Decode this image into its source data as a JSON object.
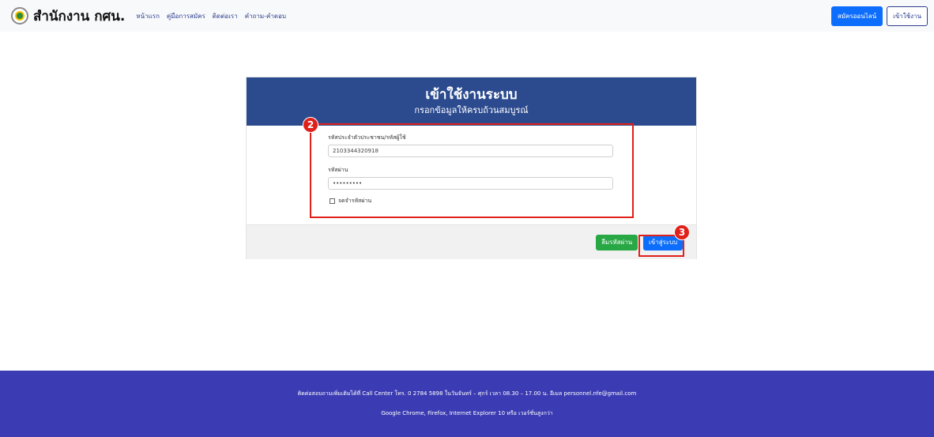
{
  "navbar": {
    "brand": "สำนักงาน กศน.",
    "links": [
      "หน้าแรก",
      "คู่มือการสมัคร",
      "ติดต่อเรา",
      "คำถาม-คำตอบ"
    ],
    "register_label": "สมัครออนไลน์",
    "login_label": "เข้าใช้งาน"
  },
  "login": {
    "title": "เข้าใช้งานระบบ",
    "subtitle": "กรอกข้อมูลให้ครบถ้วนสมบูรณ์",
    "id_label": "รหัสประจำตัวประชาชน/รหัสผู้ใช้",
    "id_value": "2103344320918",
    "password_label": "รหัสผ่าน",
    "password_value": "•••••••••",
    "remember_label": "จดจำรหัสผ่าน",
    "forgot_label": "ลืมรหัสผ่าน",
    "submit_label": "เข้าสู่ระบบ"
  },
  "annotations": {
    "badge_form": "2",
    "badge_submit": "3",
    "color": "#e0201a"
  },
  "footer": {
    "line1": "ติดต่อสอบถามเพิ่มเติมได้ที่ Call Center โทร. 0 2784 5898 ในวันจันทร์ – ศุกร์ เวลา 08.30 – 17.00 น. อีเมล personnel.nfe@gmail.com",
    "line2": "Google Chrome, Firefox, Internet Explorer 10 หรือ เวอร์ชั่นสูงกว่า"
  },
  "colors": {
    "header_blue": "#2c4b8f",
    "footer_blue": "#3b3bb3",
    "primary": "#0d6efd",
    "success": "#28a745"
  }
}
